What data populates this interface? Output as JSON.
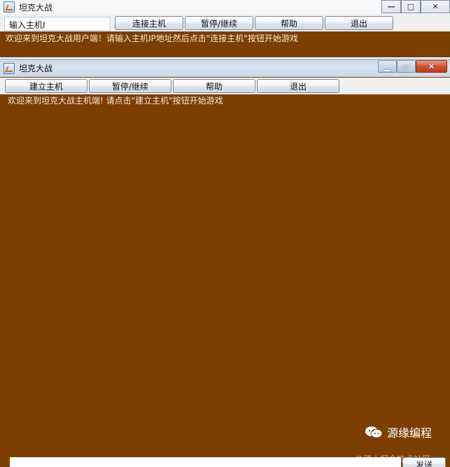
{
  "client_window": {
    "title": "坦克大战",
    "ip_input_value": "输入主机I",
    "buttons": {
      "connect": "连接主机",
      "pause": "暂停/继续",
      "help": "帮助",
      "exit": "退出"
    },
    "message": "欢迎来到坦克大战用户端！请输入主机IP地址然后点击\"连接主机\"按钮开始游戏"
  },
  "server_window": {
    "title": "坦克大战",
    "buttons": {
      "create_host": "建立主机",
      "pause": "暂停/继续",
      "help": "帮助",
      "exit": "退出"
    },
    "message": "欢迎来到坦克大战主机端! 请点击\"建立主机\"按钮开始游戏",
    "send_label": "发送",
    "canvas_color": "#7b3f00"
  },
  "watermark": {
    "brand": "源缘编程",
    "sub": "@稀土掘金技术社区"
  },
  "icons": {
    "app": "java-cup-icon",
    "minimize": "minimize-icon",
    "maximize": "maximize-icon",
    "close": "close-icon"
  }
}
